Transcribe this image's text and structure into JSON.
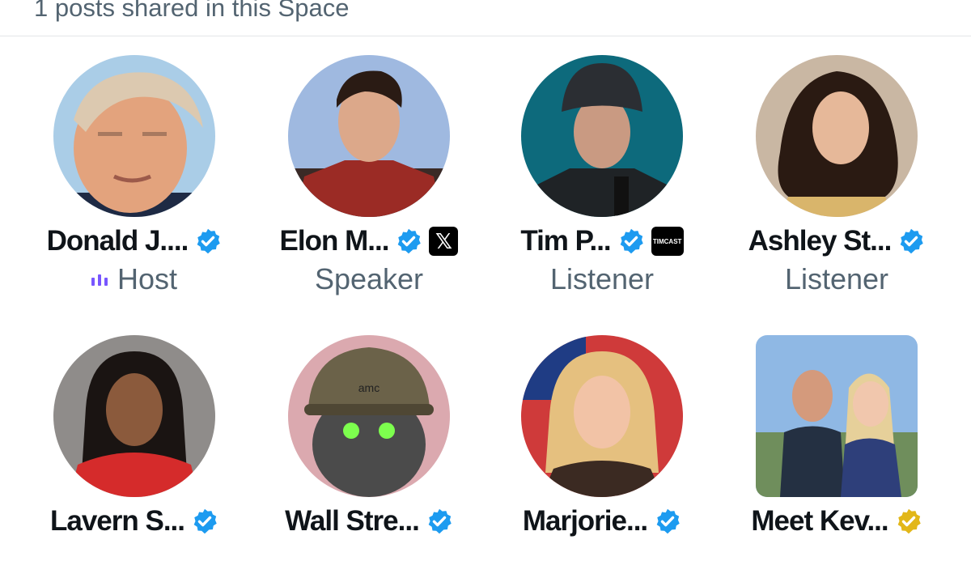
{
  "header": {
    "text": "1 posts shared in this Space"
  },
  "participants": [
    {
      "name": "Donald J....",
      "role": "Host",
      "badge": "verified-blue",
      "affiliate": null
    },
    {
      "name": "Elon M...",
      "role": "Speaker",
      "badge": "verified-blue",
      "affiliate": "𝕏"
    },
    {
      "name": "Tim P...",
      "role": "Listener",
      "badge": "verified-blue",
      "affiliate": "TIMCAST"
    },
    {
      "name": "Ashley St...",
      "role": "Listener",
      "badge": "verified-blue",
      "affiliate": null
    },
    {
      "name": "Lavern S...",
      "role": "",
      "badge": "verified-blue",
      "affiliate": null
    },
    {
      "name": "Wall Stre...",
      "role": "",
      "badge": "verified-blue",
      "affiliate": null
    },
    {
      "name": "Marjorie...",
      "role": "",
      "badge": "verified-blue",
      "affiliate": null
    },
    {
      "name": "Meet Kev...",
      "role": "",
      "badge": "verified-gold",
      "affiliate": null
    }
  ],
  "avatar_text": {
    "amc": "amc"
  },
  "colors": {
    "verified_blue": "#1d9bf0",
    "verified_gold": "#e2b719",
    "speaking_purple": "#7856ff",
    "secondary_text": "#536471",
    "divider": "#e3e6e8"
  }
}
